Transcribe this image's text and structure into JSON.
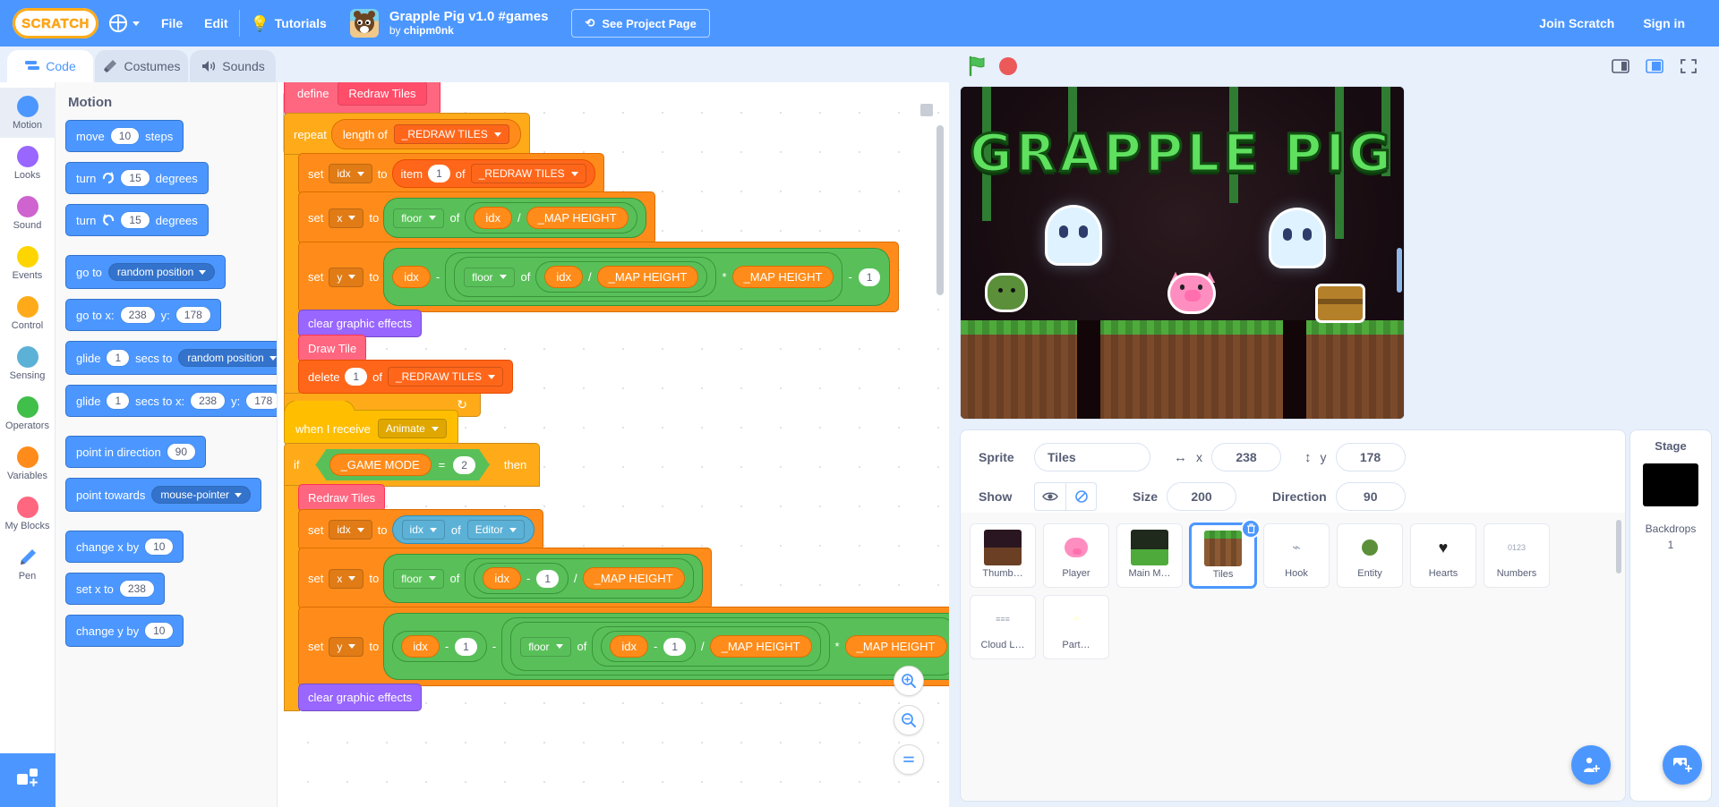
{
  "menu": {
    "logo_text": "SCRATCH",
    "language_icon": "globe-icon",
    "items": [
      "File",
      "Edit"
    ],
    "tutorials_label": "Tutorials",
    "tutorials_icon": "lightbulb-icon",
    "project_title": "Grapple Pig v1.0 #games",
    "project_author_prefix": "by ",
    "project_author": "chipm0nk",
    "see_project_label": "See Project Page",
    "see_project_icon": "remix-icon",
    "join_label": "Join Scratch",
    "signin_label": "Sign in"
  },
  "tabs": [
    {
      "label": "Code",
      "icon": "code-icon",
      "active": true
    },
    {
      "label": "Costumes",
      "icon": "paintbrush-icon",
      "active": false
    },
    {
      "label": "Sounds",
      "icon": "speaker-icon",
      "active": false
    }
  ],
  "categories": [
    {
      "label": "Motion",
      "color": "#4c97ff",
      "selected": true
    },
    {
      "label": "Looks",
      "color": "#9966ff",
      "selected": false
    },
    {
      "label": "Sound",
      "color": "#cf63cf",
      "selected": false
    },
    {
      "label": "Events",
      "color": "#ffd500",
      "selected": false
    },
    {
      "label": "Control",
      "color": "#ffab19",
      "selected": false
    },
    {
      "label": "Sensing",
      "color": "#5cb1d6",
      "selected": false
    },
    {
      "label": "Operators",
      "color": "#40bf4a",
      "selected": false
    },
    {
      "label": "Variables",
      "color": "#ff8c1a",
      "selected": false
    },
    {
      "label": "My Blocks",
      "color": "#ff6680",
      "selected": false
    },
    {
      "label": "Pen",
      "color": "#0fbd8c",
      "selected": false
    }
  ],
  "add_extension_label": "+",
  "palette": {
    "heading": "Motion",
    "blocks": [
      {
        "parts": [
          {
            "t": "text",
            "v": "move"
          },
          {
            "t": "num",
            "v": "10"
          },
          {
            "t": "text",
            "v": "steps"
          }
        ]
      },
      {
        "parts": [
          {
            "t": "text",
            "v": "turn"
          },
          {
            "t": "icon",
            "v": "turn-right-icon"
          },
          {
            "t": "num",
            "v": "15"
          },
          {
            "t": "text",
            "v": "degrees"
          }
        ]
      },
      {
        "parts": [
          {
            "t": "text",
            "v": "turn"
          },
          {
            "t": "icon",
            "v": "turn-left-icon"
          },
          {
            "t": "num",
            "v": "15"
          },
          {
            "t": "text",
            "v": "degrees"
          }
        ]
      },
      {
        "gap": true,
        "parts": [
          {
            "t": "text",
            "v": "go to"
          },
          {
            "t": "drop",
            "v": "random position"
          }
        ]
      },
      {
        "parts": [
          {
            "t": "text",
            "v": "go to x:"
          },
          {
            "t": "num",
            "v": "238"
          },
          {
            "t": "text",
            "v": "y:"
          },
          {
            "t": "num",
            "v": "178"
          }
        ]
      },
      {
        "parts": [
          {
            "t": "text",
            "v": "glide"
          },
          {
            "t": "num",
            "v": "1"
          },
          {
            "t": "text",
            "v": "secs to"
          },
          {
            "t": "drop",
            "v": "random position"
          }
        ]
      },
      {
        "parts": [
          {
            "t": "text",
            "v": "glide"
          },
          {
            "t": "num",
            "v": "1"
          },
          {
            "t": "text",
            "v": "secs to x:"
          },
          {
            "t": "num",
            "v": "238"
          },
          {
            "t": "text",
            "v": "y:"
          },
          {
            "t": "num",
            "v": "178"
          }
        ]
      },
      {
        "gap": true,
        "parts": [
          {
            "t": "text",
            "v": "point in direction"
          },
          {
            "t": "num",
            "v": "90"
          }
        ]
      },
      {
        "parts": [
          {
            "t": "text",
            "v": "point towards"
          },
          {
            "t": "drop",
            "v": "mouse-pointer"
          }
        ]
      },
      {
        "gap": true,
        "parts": [
          {
            "t": "text",
            "v": "change x by"
          },
          {
            "t": "num",
            "v": "10"
          }
        ]
      },
      {
        "parts": [
          {
            "t": "text",
            "v": "set x to"
          },
          {
            "t": "num",
            "v": "238"
          }
        ]
      },
      {
        "parts": [
          {
            "t": "text",
            "v": "change y by"
          },
          {
            "t": "num",
            "v": "10"
          }
        ]
      }
    ]
  },
  "code": {
    "script1": {
      "define_label": "define",
      "define_name": "Redraw Tiles",
      "repeat_label": "repeat",
      "length_of_label": "length of",
      "length_of_list": "_REDRAW TILES",
      "set_label": "set",
      "to_label": "to",
      "of_label": "of",
      "idx_var": "idx",
      "x_var": "x",
      "y_var": "y",
      "item_label": "item",
      "item_index": "1",
      "list_name": "_REDRAW TILES",
      "floor_label": "floor",
      "map_height": "_MAP HEIGHT",
      "minus": "-",
      "slash": "/",
      "times": "*",
      "one": "1",
      "clear_fx": "clear graphic effects",
      "draw_tile": "Draw Tile",
      "delete_label": "delete",
      "delete_index": "1",
      "loop_arrow": "↻"
    },
    "script2": {
      "hat_label": "when I receive",
      "hat_message": "Animate",
      "if_label": "if",
      "then_label": "then",
      "game_mode_var": "_GAME MODE",
      "equals": "=",
      "game_mode_value": "2",
      "redraw_tiles": "Redraw Tiles",
      "set_label": "set",
      "to_label": "to",
      "of_label": "of",
      "idx_var": "idx",
      "x_var": "x",
      "y_var": "y",
      "editor_target": "Editor",
      "floor_label": "floor",
      "map_height": "_MAP HEIGHT",
      "one": "1",
      "minus": "-",
      "slash": "/",
      "times": "*",
      "clear_fx": "clear graphic effects"
    }
  },
  "canvas_controls": {
    "zoom_in": "+",
    "zoom_out": "−",
    "zoom_reset": "="
  },
  "stage": {
    "green_flag_icon": "green-flag-icon",
    "stop_icon": "stop-sign-icon",
    "small_stage_icon": "small-stage-icon",
    "large_stage_icon": "large-stage-icon",
    "fullscreen_icon": "fullscreen-icon",
    "game_title": "GRAPPLE PIG"
  },
  "sprite_info": {
    "sprite_label": "Sprite",
    "sprite_name": "Tiles",
    "x_label": "x",
    "x_value": "238",
    "y_label": "y",
    "y_value": "178",
    "show_label": "Show",
    "show_on_icon": "eye-icon",
    "show_off_icon": "eye-crossed-icon",
    "size_label": "Size",
    "size_value": "200",
    "direction_label": "Direction",
    "direction_value": "90"
  },
  "sprites": [
    {
      "name": "Thumb…",
      "selected": false,
      "kind": "thumbnail"
    },
    {
      "name": "Player",
      "selected": false,
      "kind": "pig"
    },
    {
      "name": "Main M…",
      "selected": false,
      "kind": "menu"
    },
    {
      "name": "Tiles",
      "selected": true,
      "kind": "tiles"
    },
    {
      "name": "Hook",
      "selected": false,
      "kind": "hook"
    },
    {
      "name": "Entity",
      "selected": false,
      "kind": "entity"
    },
    {
      "name": "Hearts",
      "selected": false,
      "kind": "heart"
    },
    {
      "name": "Numbers",
      "selected": false,
      "kind": "numbers"
    },
    {
      "name": "Cloud L…",
      "selected": false,
      "kind": "cloud"
    },
    {
      "name": "Part…",
      "selected": false,
      "kind": "particles"
    }
  ],
  "add_sprite_label": "+",
  "stage_panel": {
    "header": "Stage",
    "backdrops_label": "Backdrops",
    "backdrops_count": "1",
    "add_backdrop_label": "+"
  }
}
